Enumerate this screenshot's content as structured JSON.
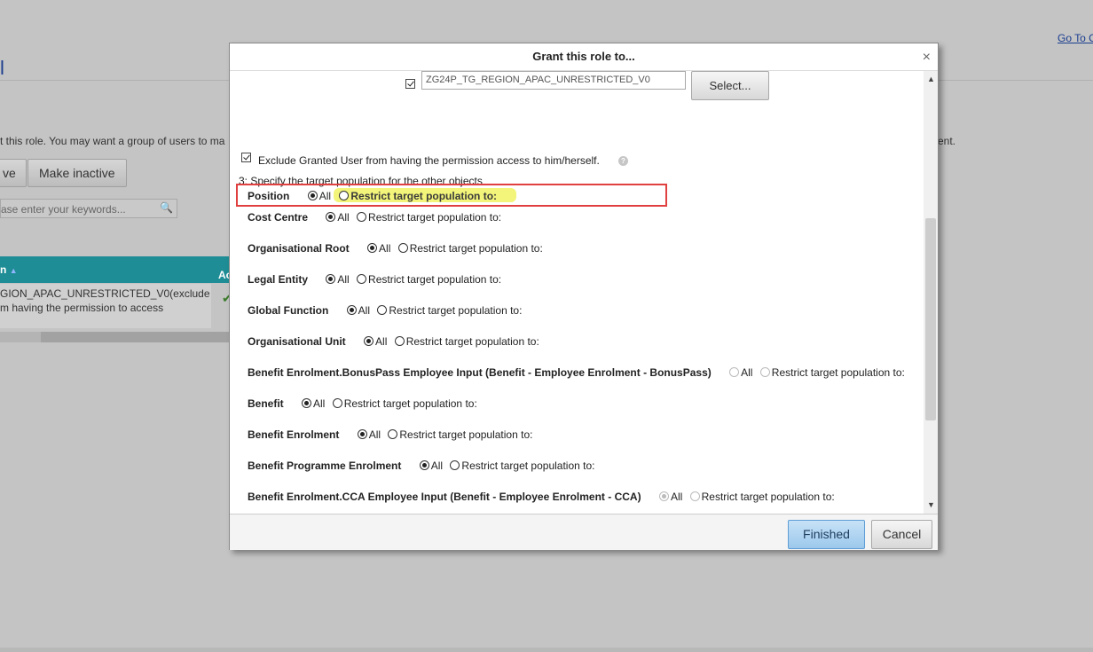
{
  "background": {
    "go_to_link": "Go To C",
    "title_fragment": "l",
    "description": "t this role. You may want a group of users to ma",
    "description_right": "ent.",
    "btn_active": "ve",
    "btn_make_inactive": "Make inactive",
    "search_placeholder": "ase enter your keywords...",
    "table_header_left": "n",
    "table_header_right": "Ac",
    "row_line1": "GION_APAC_UNRESTRICTED_V0(exclude",
    "row_line2": "m having the permission to access"
  },
  "dialog": {
    "title": "Grant this role to...",
    "close_glyph": "×",
    "group_value": "ZG24P_TG_REGION_APAC_UNRESTRICTED_V0",
    "select_label": "Select...",
    "exclude_label": "Exclude Granted User from having the permission access to him/herself.",
    "help_glyph": "?",
    "step3_label": "3: Specify the target population for the other objects",
    "all_label": "All",
    "restrict_label": "Restrict target population to:",
    "objects": [
      {
        "label": "Position",
        "all_selected": false,
        "restrict_selected": false,
        "disabled": false
      },
      {
        "label": "Cost Centre",
        "all_selected": true,
        "restrict_selected": false,
        "disabled": false
      },
      {
        "label": "Organisational Root",
        "all_selected": true,
        "restrict_selected": false,
        "disabled": false
      },
      {
        "label": "Legal Entity",
        "all_selected": true,
        "restrict_selected": false,
        "disabled": false
      },
      {
        "label": "Global Function",
        "all_selected": true,
        "restrict_selected": false,
        "disabled": false
      },
      {
        "label": "Organisational Unit",
        "all_selected": true,
        "restrict_selected": false,
        "disabled": false
      },
      {
        "label": "Benefit Enrolment.BonusPass Employee Input (Benefit - Employee Enrolment - BonusPass)",
        "all_selected": false,
        "restrict_selected": false,
        "disabled": true
      },
      {
        "label": "Benefit",
        "all_selected": true,
        "restrict_selected": false,
        "disabled": false
      },
      {
        "label": "Benefit Enrolment",
        "all_selected": true,
        "restrict_selected": false,
        "disabled": false
      },
      {
        "label": "Benefit Programme Enrolment",
        "all_selected": true,
        "restrict_selected": false,
        "disabled": false
      },
      {
        "label": "Benefit Enrolment.CCA Employee Input (Benefit - Employee Enrolment - CCA)",
        "all_selected": true,
        "restrict_selected": false,
        "disabled": true
      }
    ],
    "finished_label": "Finished",
    "cancel_label": "Cancel"
  },
  "colors": {
    "overlay_bg": "#c4c4c4",
    "highlight": "#f3f57a",
    "annotation_box": "#e04040",
    "table_header": "#1f8d95",
    "primary_button": "#9cc8ec"
  }
}
